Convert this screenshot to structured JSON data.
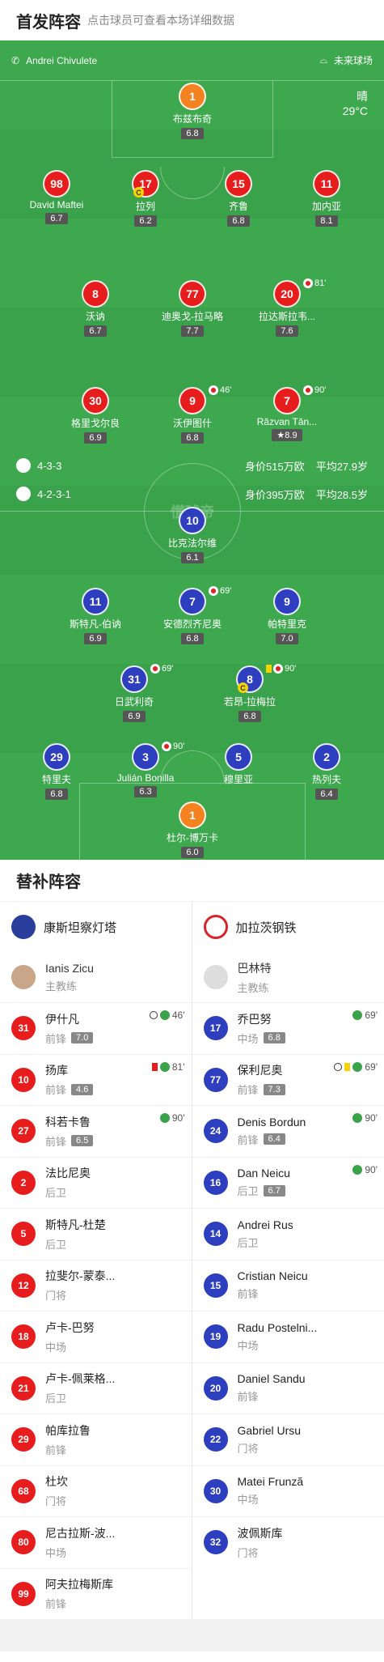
{
  "header": {
    "title": "首发阵容",
    "subtitle": "点击球员可查看本场详细数据"
  },
  "pitch": {
    "referee": "Andrei Chivulete",
    "venue": "未来球场",
    "weather": "晴",
    "temperature": "29°C",
    "watermark": "懂球帝",
    "home_formation": "4-3-3",
    "home_value": "身价515万欧",
    "home_age": "平均27.9岁",
    "away_formation": "4-2-3-1",
    "away_value": "身价395万欧",
    "away_age": "平均28.5岁"
  },
  "home_players": [
    {
      "num": "1",
      "name": "布兹布奇",
      "rating": "6.8"
    },
    {
      "num": "98",
      "name": "David Maftei",
      "rating": "6.7"
    },
    {
      "num": "17",
      "name": "拉列",
      "rating": "6.2"
    },
    {
      "num": "15",
      "name": "齐鲁",
      "rating": "6.8"
    },
    {
      "num": "11",
      "name": "加内亚",
      "rating": "8.1"
    },
    {
      "num": "8",
      "name": "沃讷",
      "rating": "6.7"
    },
    {
      "num": "77",
      "name": "迪奥戈-拉马略",
      "rating": "7.7"
    },
    {
      "num": "20",
      "name": "拉达斯拉韦...",
      "rating": "7.6",
      "event": "81'"
    },
    {
      "num": "30",
      "name": "格里戈尔良",
      "rating": "6.9"
    },
    {
      "num": "9",
      "name": "沃伊图什",
      "rating": "6.8",
      "event": "46'"
    },
    {
      "num": "7",
      "name": "Răzvan Tăn...",
      "rating": "8.9",
      "event": "90'"
    }
  ],
  "away_players": [
    {
      "num": "10",
      "name": "比克法尔维",
      "rating": "6.1"
    },
    {
      "num": "11",
      "name": "斯特凡-伯讷",
      "rating": "6.9"
    },
    {
      "num": "7",
      "name": "安德烈齐尼奥",
      "rating": "6.8",
      "event": "69'"
    },
    {
      "num": "9",
      "name": "帕特里克",
      "rating": "7.0"
    },
    {
      "num": "31",
      "name": "日武利奇",
      "rating": "6.9",
      "event": "69'"
    },
    {
      "num": "8",
      "name": "若昂-拉梅拉",
      "rating": "6.8",
      "event": "90'"
    },
    {
      "num": "29",
      "name": "特里夫",
      "rating": "6.8"
    },
    {
      "num": "3",
      "name": "Julián Bonilla",
      "rating": "6.3",
      "event": "90'"
    },
    {
      "num": "5",
      "name": "穆里亚",
      "rating": ""
    },
    {
      "num": "2",
      "name": "热列夫",
      "rating": "6.4"
    },
    {
      "num": "1",
      "name": "杜尔-博万卡",
      "rating": "6.0"
    }
  ],
  "subs": {
    "title": "替补阵容",
    "home_team": "康斯坦察灯塔",
    "away_team": "加拉茨钢铁",
    "home_coach": {
      "name": "Ianis Zicu",
      "role": "主教练"
    },
    "away_coach": {
      "name": "巴林特",
      "role": "主教练"
    },
    "home": [
      {
        "num": "31",
        "name": "伊什凡",
        "pos": "前锋",
        "rating": "7.0",
        "event": "46'"
      },
      {
        "num": "10",
        "name": "扬库",
        "pos": "前锋",
        "rating": "4.6",
        "event": "81'"
      },
      {
        "num": "27",
        "name": "科若卡鲁",
        "pos": "前锋",
        "rating": "6.5",
        "event": "90'"
      },
      {
        "num": "2",
        "name": "法比尼奥",
        "pos": "后卫",
        "rating": ""
      },
      {
        "num": "5",
        "name": "斯特凡-杜楚",
        "pos": "后卫",
        "rating": ""
      },
      {
        "num": "12",
        "name": "拉斐尔-蒙泰...",
        "pos": "门将",
        "rating": ""
      },
      {
        "num": "18",
        "name": "卢卡-巴努",
        "pos": "中场",
        "rating": ""
      },
      {
        "num": "21",
        "name": "卢卡-佩莱格...",
        "pos": "后卫",
        "rating": ""
      },
      {
        "num": "29",
        "name": "帕库拉鲁",
        "pos": "前锋",
        "rating": ""
      },
      {
        "num": "68",
        "name": "杜坎",
        "pos": "门将",
        "rating": ""
      },
      {
        "num": "80",
        "name": "尼古拉斯-波...",
        "pos": "中场",
        "rating": ""
      },
      {
        "num": "99",
        "name": "阿夫拉梅斯库",
        "pos": "前锋",
        "rating": ""
      }
    ],
    "away": [
      {
        "num": "17",
        "name": "乔巴努",
        "pos": "中场",
        "rating": "6.8",
        "event": "69'"
      },
      {
        "num": "77",
        "name": "保利尼奥",
        "pos": "前锋",
        "rating": "7.3",
        "event": "69'"
      },
      {
        "num": "24",
        "name": "Denis Bordun",
        "pos": "前锋",
        "rating": "6.4",
        "event": "90'"
      },
      {
        "num": "16",
        "name": "Dan Neicu",
        "pos": "后卫",
        "rating": "6.7",
        "event": "90'"
      },
      {
        "num": "14",
        "name": "Andrei Rus",
        "pos": "后卫",
        "rating": ""
      },
      {
        "num": "15",
        "name": "Cristian Neicu",
        "pos": "前锋",
        "rating": ""
      },
      {
        "num": "19",
        "name": "Radu Postelni...",
        "pos": "中场",
        "rating": ""
      },
      {
        "num": "20",
        "name": "Daniel Sandu",
        "pos": "前锋",
        "rating": ""
      },
      {
        "num": "22",
        "name": "Gabriel Ursu",
        "pos": "门将",
        "rating": ""
      },
      {
        "num": "30",
        "name": "Matei Frunză",
        "pos": "中场",
        "rating": ""
      },
      {
        "num": "32",
        "name": "波佩斯库",
        "pos": "门将",
        "rating": ""
      }
    ]
  },
  "colors": {
    "pitch": "#3aa24a",
    "home": "#e71d1d",
    "away": "#2d3ebf",
    "keeper": "#f58220"
  }
}
